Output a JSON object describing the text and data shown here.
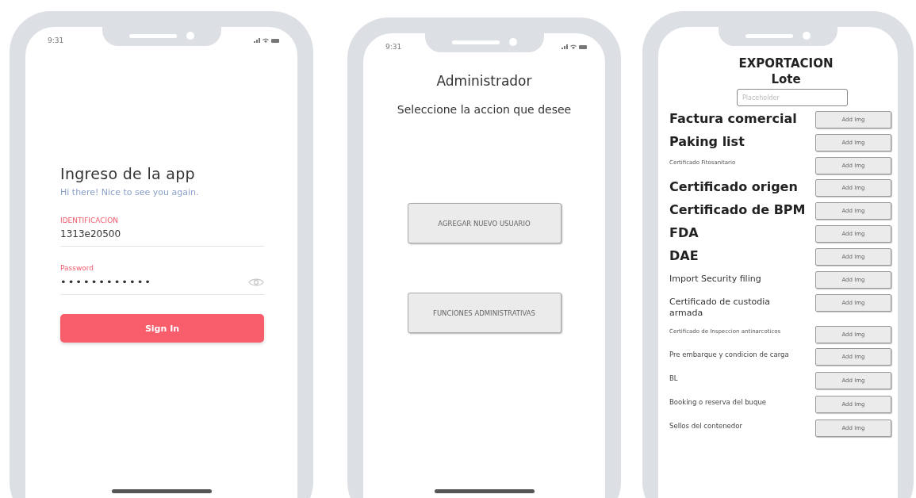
{
  "login_screen": {
    "status_time": "9:31",
    "title": "Ingreso de la app",
    "subtitle": "Hi there! Nice to see you again.",
    "fields": [
      {
        "label": "IDENTIFICACION",
        "value": "1313e20500",
        "kind": "text"
      },
      {
        "label": "Password",
        "value": "••••••••••••",
        "kind": "password"
      }
    ],
    "button": "Sign In"
  },
  "admin_screen": {
    "status_time": "9:31",
    "title": "Administrador",
    "subtitle": "Seleccione la accion que desee",
    "buttons": [
      "AGREGAR NUEVO USUARIO",
      "FUNCIONES ADMINISTRATIVAS"
    ]
  },
  "export_screen": {
    "title": "EXPORTACION",
    "subtitle": "Lote",
    "lot_field": {
      "placeholder": "Placeholder"
    },
    "documents": [
      {
        "label": "Factura comercial",
        "kind": "large",
        "button": "Add Img"
      },
      {
        "label": "Paking list",
        "kind": "large",
        "button": "Add Img"
      },
      {
        "label": "Certificado Fitosanitario",
        "kind": "small",
        "button": "Add Img"
      },
      {
        "label": "Certificado origen",
        "kind": "large",
        "button": "Add Img"
      },
      {
        "label": "Certificado de BPM",
        "kind": "large",
        "button": "Add Img"
      },
      {
        "label": "FDA",
        "kind": "large",
        "button": "Add Img"
      },
      {
        "label": "DAE",
        "kind": "large",
        "button": "Add Img"
      },
      {
        "label": "Import Security filing",
        "kind": "medium",
        "button": "Add Img"
      },
      {
        "label": "Certificado de custodia armada",
        "kind": "medium",
        "button": "Add Img"
      },
      {
        "label": "Certificado de Inspeccion antinarcoticos",
        "kind": "tiny",
        "button": "Add Img"
      },
      {
        "label": "Pre embarque y condicion de carga",
        "kind": "normal",
        "button": "Add Img"
      },
      {
        "label": "BL",
        "kind": "normal",
        "button": "Add Img"
      },
      {
        "label": "Booking o reserva del buque",
        "kind": "normal",
        "button": "Add Img"
      },
      {
        "label": "Sellos del contenedor",
        "kind": "normal",
        "button": "Add Img"
      }
    ]
  }
}
